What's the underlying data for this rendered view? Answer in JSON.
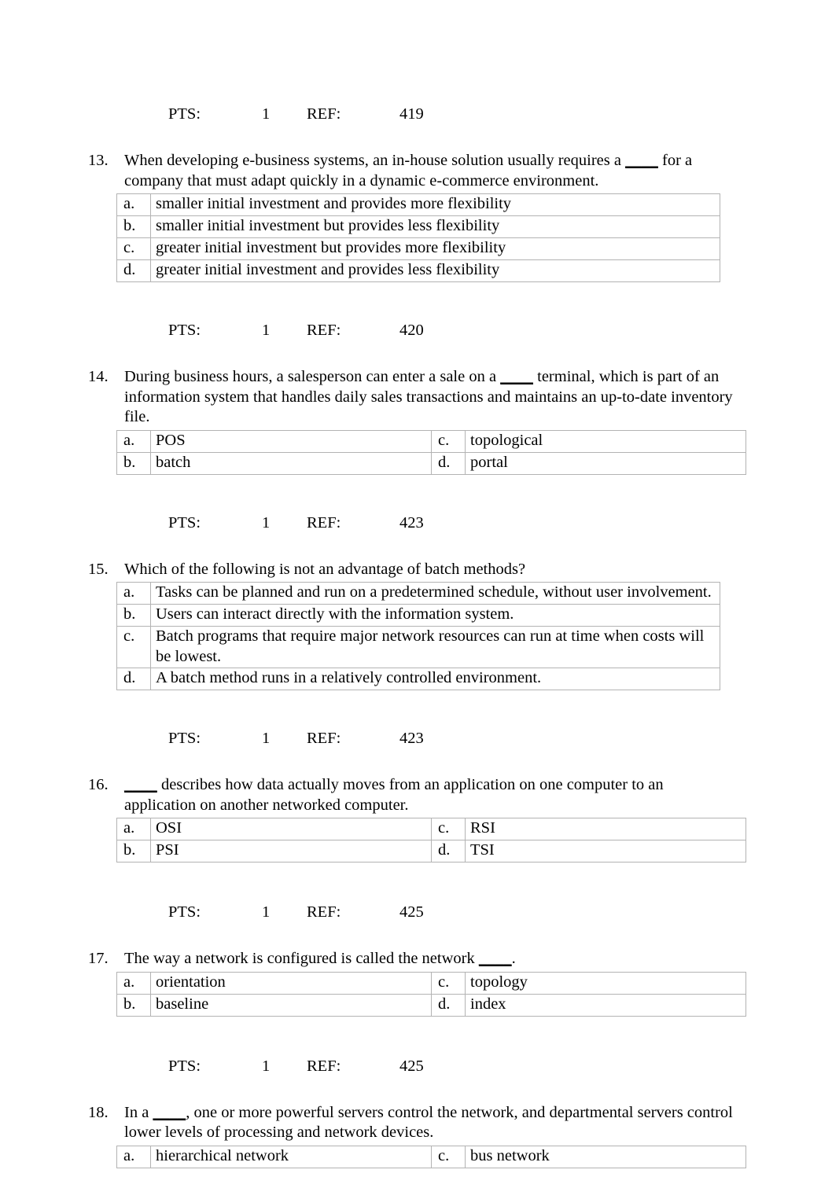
{
  "page": {
    "label_pts": "PTS:",
    "label_ref": "REF:"
  },
  "blocks": [
    {
      "kind": "pts",
      "pts": "1",
      "ref": "419"
    },
    {
      "kind": "question",
      "number": "13.",
      "text_before": "When developing e-business systems, an in-house solution usually requires a ",
      "blank": "____",
      "text_after": " for a company that must adapt quickly in a dynamic e-commerce environment.",
      "layout": "one-column",
      "options": [
        {
          "letter": "a.",
          "text": "smaller initial investment and provides more flexibility"
        },
        {
          "letter": "b.",
          "text": "smaller initial investment but provides less flexibility"
        },
        {
          "letter": "c.",
          "text": "greater initial investment but provides more flexibility"
        },
        {
          "letter": "d.",
          "text": "greater initial investment and provides less flexibility"
        }
      ]
    },
    {
      "kind": "pts",
      "pts": "1",
      "ref": "420"
    },
    {
      "kind": "question",
      "number": "14.",
      "text_before": "During business hours, a salesperson can enter a sale on a ",
      "blank": "____",
      "text_after": " terminal, which is part of an information system that handles daily sales transactions and maintains an up-to-date inventory file.",
      "layout": "two-column",
      "options": [
        {
          "letter": "a.",
          "text": "POS"
        },
        {
          "letter": "c.",
          "text": "topological"
        },
        {
          "letter": "b.",
          "text": "batch"
        },
        {
          "letter": "d.",
          "text": "portal"
        }
      ]
    },
    {
      "kind": "pts",
      "pts": "1",
      "ref": "423"
    },
    {
      "kind": "question",
      "number": "15.",
      "text_before": "Which of the following is not an advantage of batch methods?",
      "blank": "",
      "text_after": "",
      "layout": "one-column",
      "options": [
        {
          "letter": "a.",
          "text": "Tasks can be planned and run on a predetermined schedule, without user involvement."
        },
        {
          "letter": "b.",
          "text": "Users can interact directly with the information system."
        },
        {
          "letter": "c.",
          "text": "Batch programs that require major network resources can run at time when costs will be lowest."
        },
        {
          "letter": "d.",
          "text": "A batch method runs in a relatively controlled environment."
        }
      ]
    },
    {
      "kind": "pts",
      "pts": "1",
      "ref": "423"
    },
    {
      "kind": "question",
      "number": "16.",
      "text_before": "",
      "blank": "____",
      "text_after": " describes how data actually moves from an application on one computer to an application on another networked computer.",
      "layout": "two-column",
      "options": [
        {
          "letter": "a.",
          "text": "OSI"
        },
        {
          "letter": "c.",
          "text": "RSI"
        },
        {
          "letter": "b.",
          "text": "PSI"
        },
        {
          "letter": "d.",
          "text": "TSI"
        }
      ]
    },
    {
      "kind": "pts",
      "pts": "1",
      "ref": "425"
    },
    {
      "kind": "question",
      "number": "17.",
      "text_before": "The way a network is configured is called the network ",
      "blank": "____",
      "text_after": ".",
      "layout": "two-column",
      "options": [
        {
          "letter": "a.",
          "text": "orientation"
        },
        {
          "letter": "c.",
          "text": "topology"
        },
        {
          "letter": "b.",
          "text": "baseline"
        },
        {
          "letter": "d.",
          "text": "index"
        }
      ]
    },
    {
      "kind": "pts",
      "pts": "1",
      "ref": "425"
    },
    {
      "kind": "question",
      "number": "18.",
      "text_before": "In a ",
      "blank": "____",
      "text_after": ", one or more powerful servers control the network, and departmental servers control lower levels of processing and network devices.",
      "layout": "two-column",
      "options": [
        {
          "letter": "a.",
          "text": "hierarchical network"
        },
        {
          "letter": "c.",
          "text": "bus network"
        }
      ]
    }
  ]
}
